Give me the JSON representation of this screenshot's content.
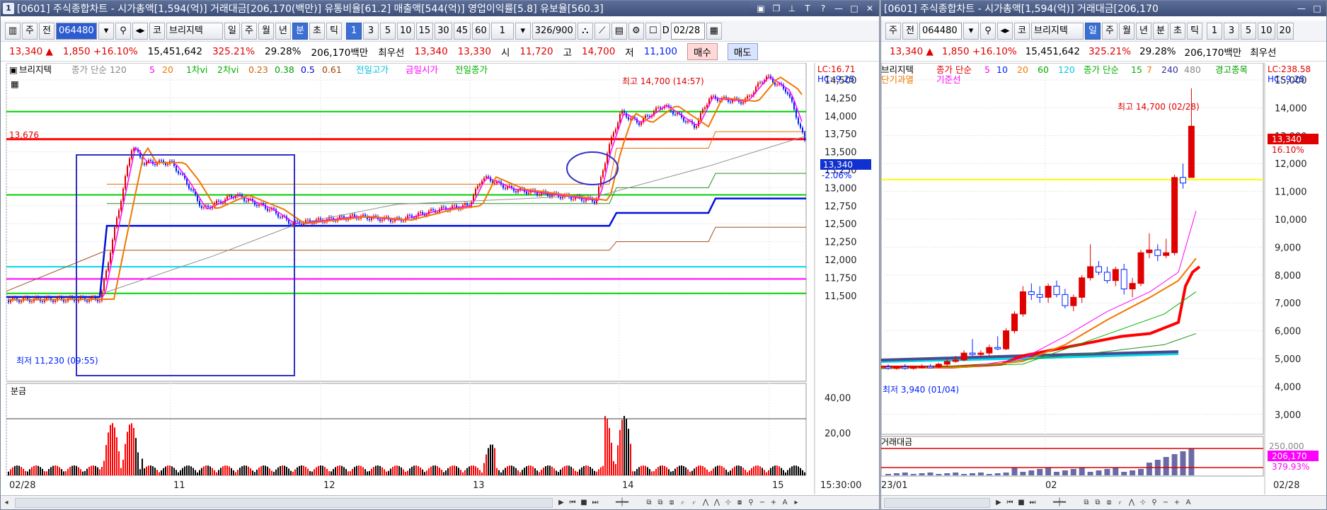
{
  "left": {
    "title_num": "1",
    "title": "[0601] 주식종합차트 - 시가총액[1,594(억)] 거래대금[206,170(백만)] 유통비율[61.2] 매출액[544(억)] 영업이익률[5.8] 유보율[560.3]",
    "toolbar": {
      "week": "주",
      "prev": "전",
      "code": "064480",
      "market": "코",
      "stock": "브리지텍",
      "periods": [
        "일",
        "주",
        "월",
        "년",
        "분",
        "초",
        "틱"
      ],
      "active_period": "분",
      "intervals": [
        "1",
        "3",
        "5",
        "10",
        "15",
        "30",
        "45",
        "60"
      ],
      "active_interval": "1",
      "unit": "1",
      "count": "326",
      "count_total": "/900",
      "d_label": "D",
      "date": "02/28"
    },
    "quote": {
      "price": "13,340 ▲",
      "change": "1,850 +16.10%",
      "volume": "15,451,642",
      "turnover_pct": "325.21%",
      "ratio": "29.28%",
      "amount": "206,170백만",
      "best_label": "최우선",
      "best_ask": "13,340",
      "best_bid": "13,330",
      "open_label": "시",
      "open": "11,720",
      "high_label": "고",
      "high": "14,700",
      "low_label": "저",
      "low": "11,100",
      "buy": "매수",
      "sell": "매도"
    },
    "legend": {
      "name": "브리지텍",
      "ma_label": "종가 단순 120",
      "ma5": "5",
      "ma20": "20",
      "res1": "1차vi",
      "res2": "2차vi",
      "fib1": "0.23",
      "fib2": "0.38",
      "fib3": "0.5",
      "fib4": "0.61",
      "prev_high": "전일고가",
      "today_open": "금일시가",
      "prev_close": "전일종가"
    },
    "lc": "LC:16.71",
    "hc": "HC:-9.25",
    "high_annotation": "최고 14,700 (14:57)",
    "low_annotation": "최저 11,230 (09:55)",
    "level_value": "13,676",
    "price_tag": "13,340",
    "price_tag_pct": "-2.06%",
    "yticks": [
      "14,500",
      "14,250",
      "14,000",
      "13,750",
      "13,500",
      "13,250",
      "13,000",
      "12,750",
      "12,500",
      "12,250",
      "12,000",
      "11,750",
      "11,500"
    ],
    "vol_label": "분금",
    "vol_ticks": [
      "40,00",
      "20,00"
    ],
    "xlabels": [
      "02/28",
      "11",
      "12",
      "13",
      "14",
      "15"
    ],
    "time": "15:30:00"
  },
  "right": {
    "title": "[0601] 주식종합차트 - 시가총액[1,594(억)] 거래대금[206,170",
    "toolbar": {
      "week": "주",
      "prev": "전",
      "code": "064480",
      "market": "코",
      "stock": "브리지텍",
      "periods": [
        "일",
        "주",
        "월",
        "년",
        "분",
        "초",
        "틱"
      ],
      "active_period": "일",
      "intervals": [
        "1",
        "3",
        "5",
        "10",
        "20"
      ]
    },
    "quote": {
      "price": "13,340 ▲",
      "change": "1,850 +16.10%",
      "volume": "15,451,642",
      "turnover_pct": "325.21%",
      "ratio": "29.28%",
      "amount": "206,170백만",
      "best_label": "최우선"
    },
    "legend": {
      "name": "브리지텍",
      "ma_label": "종가 단순",
      "ma5": "5",
      "ma10": "10",
      "ma20": "20",
      "ma60": "60",
      "ma120": "120",
      "ma2_label": "종가 단순",
      "ma15": "15",
      "ma7": "7",
      "ma240": "240",
      "ma480": "480",
      "warning": "경고종목",
      "overheat": "단기과열",
      "base": "기준선"
    },
    "lc": "LC:238.58",
    "hc": "HC:-9.25",
    "high_annotation": "최고 14,700 (02/28)",
    "low_annotation": "최저 3,940 (01/04)",
    "price_tag": "13,340",
    "price_tag_pct": "16.10%",
    "yticks": [
      "15,000",
      "14,000",
      "13,000",
      "12,000",
      "11,000",
      "10,000",
      "9,000",
      "8,000",
      "7,000",
      "6,000",
      "5,000",
      "4,000",
      "3,000"
    ],
    "vol_label": "거래대금",
    "vol_tag": "206,170",
    "vol_tag_pct": "379.93%",
    "vol_tick": "250,000",
    "xlabels": [
      "23/01",
      "02"
    ],
    "date": "02/28"
  },
  "colors": {
    "up": "#e00000",
    "down": "#0020ff",
    "title_bar": "#3e4f78",
    "ma_orange": "#f07800",
    "ma_gray": "#909090",
    "level_green": "#00d000",
    "level_cyan": "#00d8e8",
    "level_magenta": "#ff00ff",
    "level_red": "#ff0000",
    "level_blue": "#0010e0",
    "box_blue": "#3030c8"
  }
}
